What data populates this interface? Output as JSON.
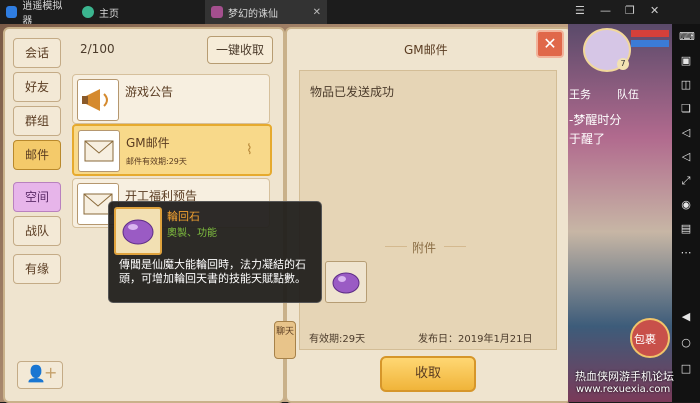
{
  "emulator": {
    "tabs": [
      {
        "label": "逍遥模拟器",
        "icon": "app-logo-icon"
      },
      {
        "label": "主页",
        "icon": "home-icon"
      },
      {
        "label": "梦幻的诛仙",
        "icon": "game-icon"
      }
    ],
    "window_controls": [
      "menu-icon",
      "minimize-icon",
      "restore-icon",
      "close-icon"
    ]
  },
  "sidebar": {
    "icons": [
      "keyboard-icon",
      "screenshot-icon",
      "gamepad-icon",
      "multi-window-icon",
      "volume-up-icon",
      "volume-down-icon",
      "fullscreen-icon",
      "location-icon",
      "folder-icon",
      "more-icon",
      "back-icon",
      "home-nav-icon",
      "recent-apps-icon"
    ]
  },
  "left_panel": {
    "tabs": [
      "会话",
      "好友",
      "群组",
      "邮件",
      "空间",
      "战队",
      "有缘"
    ],
    "active_tab": "邮件",
    "count": "2/100",
    "collect_all": "一键收取",
    "mails": [
      {
        "title": "游戏公告",
        "subtitle": "",
        "icon": "megaphone-icon"
      },
      {
        "title": "GM邮件",
        "subtitle": "邮件有效期:29天",
        "icon": "envelope-icon",
        "selected": true
      },
      {
        "title": "开工福利预告",
        "subtitle": "",
        "icon": "envelope-icon"
      }
    ]
  },
  "mail_detail": {
    "title": "GM邮件",
    "body": "物品已发送成功",
    "attachment_label": "附件",
    "expiry": "有效期:29天",
    "sent_date": "发布日：2019年1月21日",
    "collect_button": "收取"
  },
  "tooltip": {
    "item_name": "輪回石",
    "item_tags": "奧製、功能",
    "description": "傳聞是仙魔大能輪回時，法力凝結的石頭，可增加輪回天書的技能天賦點數。"
  },
  "hang_tag": "聊天",
  "game_bg": {
    "level": "7",
    "label1": "王务",
    "label2": "队伍",
    "story_line1": "-梦醒时分",
    "story_line2": "于醒了",
    "pack_label": "包裹"
  },
  "watermark": {
    "line1": "热血侠网游手机论坛",
    "line2": "www.rexuexia.com"
  },
  "colors": {
    "panel_bg": "#efe4cf",
    "accent_gold": "#f0b43a",
    "close_red": "#e0684a",
    "tooltip_name": "#f0a030",
    "tooltip_tags": "#7fbf3f"
  }
}
